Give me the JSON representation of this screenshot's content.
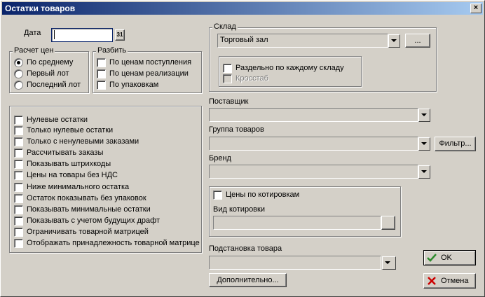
{
  "window": {
    "title": "Остатки товаров",
    "close": "×"
  },
  "date": {
    "label": "Дата",
    "value": "",
    "calendar_icon": "31"
  },
  "price_calc": {
    "title": "Расчет цен",
    "options": [
      {
        "label": "По среднему",
        "selected": true
      },
      {
        "label": "Первый лот",
        "selected": false
      },
      {
        "label": "Последний лот",
        "selected": false
      }
    ]
  },
  "split": {
    "title": "Разбить",
    "options": [
      "По ценам поступления",
      "По ценам реализации",
      "По упаковкам"
    ]
  },
  "warehouse": {
    "title": "Склад",
    "value": "Торговый зал",
    "more_button": "...",
    "per_warehouse": "Раздельно по каждому складу",
    "crosstab": "Кросстаб"
  },
  "options_list": [
    "Нулевые остатки",
    "Только нулевые остатки",
    "Только с ненулевыми заказами",
    "Рассчитывать заказы",
    "Показывать штрихкоды",
    "Цены на товары без НДС",
    "Ниже минимального остатка",
    "Остаток показывать без упаковок",
    "Показывать минимальные остатки",
    "Показывать с учетом будущих драфт",
    "Ограничивать товарной матрицей",
    "Отображать принадлежность товарной матрице"
  ],
  "supplier": {
    "label": "Поставщик",
    "value": ""
  },
  "product_group": {
    "label": "Группа товаров",
    "value": "",
    "filter_button": "Фильтр..."
  },
  "brand": {
    "label": "Бренд",
    "value": ""
  },
  "quotes": {
    "checkbox": "Цены по котировкам",
    "kind_label": "Вид котировки",
    "value": ""
  },
  "substitution": {
    "label": "Подстановка товара",
    "value": ""
  },
  "buttons": {
    "more": "Дополнительно...",
    "ok": "OK",
    "cancel": "Отмена"
  },
  "colors": {
    "title_start": "#0a246a",
    "title_end": "#a6caf0",
    "face": "#d4d0c8",
    "ok_check": "#2e8b2e",
    "cancel_x": "#cc0000"
  }
}
